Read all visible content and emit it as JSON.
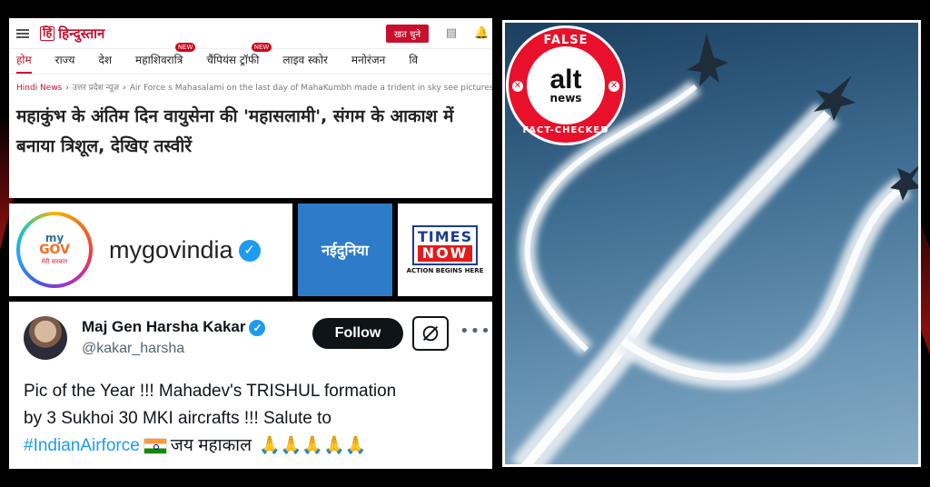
{
  "hindustan": {
    "logo_mark": "हि",
    "logo_text": "हिन्दुस्तान",
    "subscribe_label": "खत चुने",
    "nav": [
      {
        "label": "होम",
        "active": true,
        "new": false
      },
      {
        "label": "राज्य",
        "active": false,
        "new": false
      },
      {
        "label": "देश",
        "active": false,
        "new": false
      },
      {
        "label": "महाशिवरात्रि",
        "active": false,
        "new": true
      },
      {
        "label": "चैंपियंस ट्रॉफी",
        "active": false,
        "new": true
      },
      {
        "label": "लाइव स्कोर",
        "active": false,
        "new": false
      },
      {
        "label": "मनोरंजन",
        "active": false,
        "new": false
      },
      {
        "label": "वि",
        "active": false,
        "new": false
      }
    ],
    "new_badge": "NEW",
    "breadcrumb": {
      "item1": "Hindi News",
      "item2": "उत्तर प्रदेश न्यूज़",
      "item3": "Air Force s Mahasalami on the last day of MahaKumbh made a trident in sky see pictures"
    },
    "headline": "महाकुंभ के अंतिम दिन वायुसेना की 'महासलामी', संगम के आकाश में बनाया त्रिशूल, देखिए तस्वीरें"
  },
  "mygov": {
    "badge_line1": "my",
    "badge_line2": "GOV",
    "badge_line3": "मेरी सरकार",
    "handle": "mygovindia",
    "verified_glyph": "✓"
  },
  "naidunia": {
    "name": "नईदुनिया"
  },
  "timesnow": {
    "line1": "TIMES",
    "line2": "NOW",
    "tagline": "ACTION BEGINS HERE"
  },
  "tweet": {
    "name": "Maj Gen Harsha Kakar",
    "handle": "@kakar_harsha",
    "follow_label": "Follow",
    "more_glyph": "•••",
    "text_line1": "Pic of the Year !!! Mahadev's TRISHUL formation",
    "text_line2": "by 3 Sukhoi 30 MKI aircrafts !!! Salute to",
    "hashtag": "#IndianAirforce",
    "text_tail": "जय महाकाल",
    "emojis": "🙏🙏🙏🙏🙏"
  },
  "factcheck": {
    "verdict": "FALSE",
    "brand": "alt",
    "brand_sub": "news",
    "stamp": "FACT-CHECKED",
    "x_glyph": "✕"
  },
  "colors": {
    "hindustan_red": "#c8102e",
    "twitter_blue": "#1d9bf0",
    "naidunia_blue": "#2d7bc9",
    "badge_red": "#e8102a"
  }
}
